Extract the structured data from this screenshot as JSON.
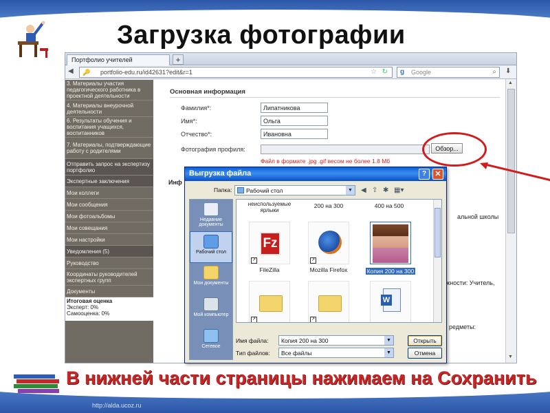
{
  "slide": {
    "title": "Загрузка фотографии",
    "caption": "В нижней части страницы нажимаем на Сохранить",
    "footer_url": "http://alda.ucoz.ru",
    "accent_color": "#c62828",
    "band_color": "#2c57a8"
  },
  "browser": {
    "tab_label": "Портфолио учителей",
    "new_tab": "+",
    "url": "portfolio-edu.ru/id42631?edit&r=1",
    "search_placeholder": "Google"
  },
  "sidebar": {
    "items": [
      "3. Материалы участия педагогического работника в проектной деятельности",
      "4. Материалы внеурочной деятельности",
      "6. Результаты обучения и воспитания учащихся, воспитанников",
      "7. Материалы, подтверждающие работу с родителями",
      "Отправить запрос на экспертизу портфолио",
      "Экспертные заключения",
      "Мои коллеги",
      "Мои сообщения",
      "Мои фотоальбомы",
      "Мои совещания",
      "Мои настройки",
      "Уведомления (5)",
      "Руководство",
      "Координаты руководителей экспертных групп",
      "Документы"
    ],
    "summary_title": "Итоговая оценка",
    "summary_expert": "Эксперт: 0%",
    "summary_self": "Самооценка: 0%"
  },
  "form": {
    "section_title": "Основная информация",
    "surname_label": "Фамилия*:",
    "surname_value": "Липатникова",
    "name_label": "Имя*:",
    "name_value": "Ольга",
    "patronymic_label": "Отчество*:",
    "patronymic_value": "Ивановна",
    "photo_label": "Фотография профиля:",
    "browse_label": "Обзор...",
    "hint": "Файл в формате .jpg .gif весом не более 1.8 Мб",
    "partial_section": "Инф",
    "partial_school": "альной школы",
    "partial_position": "лжности: Учитель,",
    "partial_subjects": "редметы:"
  },
  "dialog": {
    "title": "Выгрузка файла",
    "folder_label": "Папка:",
    "folder_value": "Рабочий стол",
    "places": [
      "Недавние документы",
      "Рабочий стол",
      "Мои документы",
      "Мой компьютер",
      "Сетевое"
    ],
    "top_labels": [
      "неиспользуемые ярлыки",
      "200 на 300",
      "400 на 500"
    ],
    "files": [
      "FileZilla",
      "Mozilla Firefox",
      "Копия 200 на 300"
    ],
    "filename_label": "Имя файла:",
    "filename_value": "Копия 200 на 300",
    "filetype_label": "Тип файлов:",
    "filetype_value": "Все файлы",
    "open_label": "Открыть",
    "cancel_label": "Отмена",
    "filezilla_glyph": "Fz"
  }
}
